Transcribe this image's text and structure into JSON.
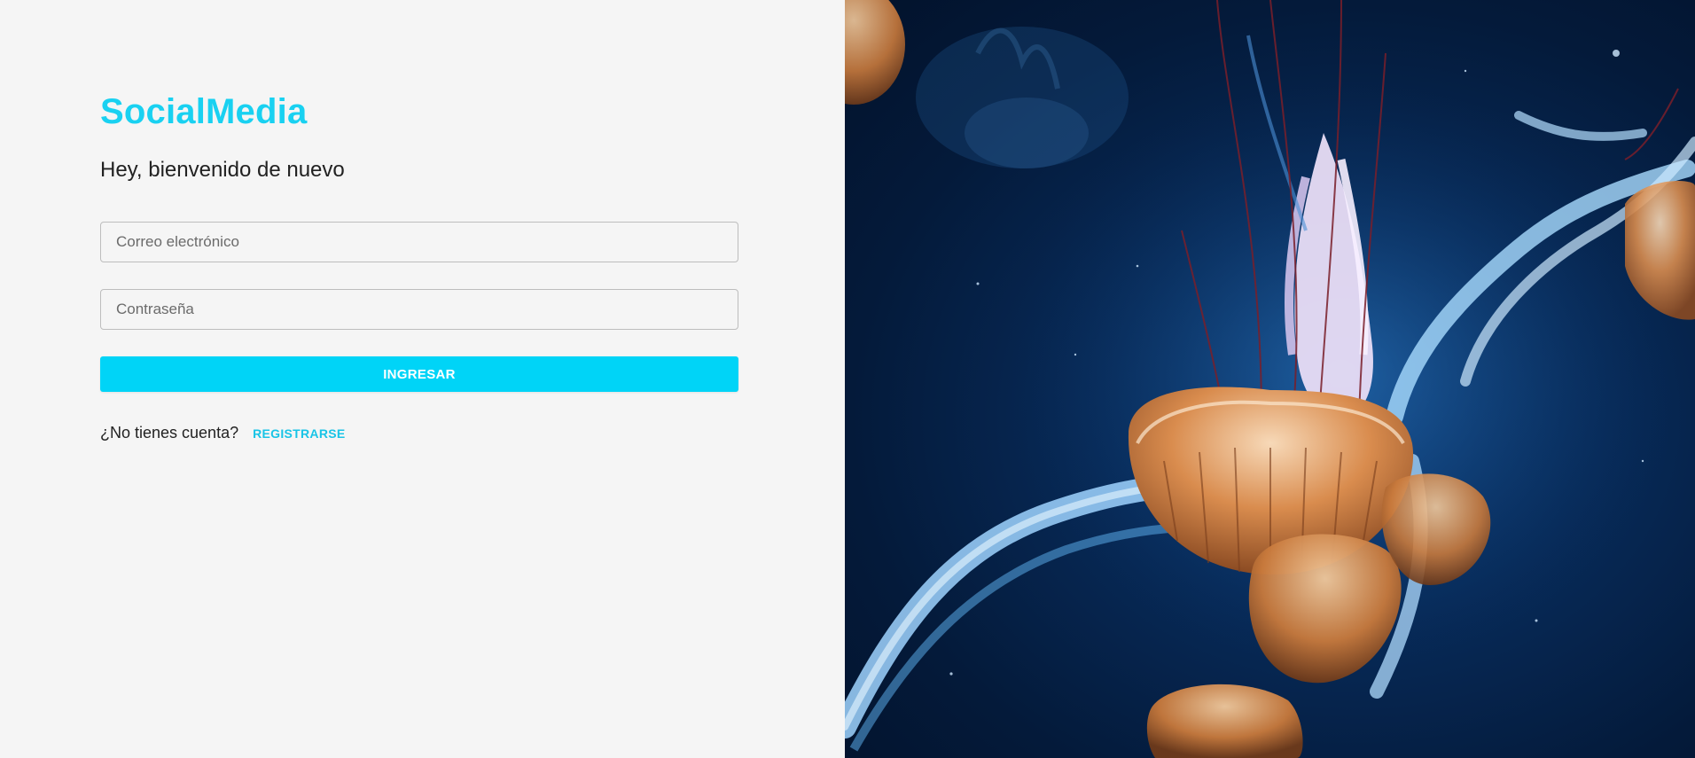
{
  "brand": {
    "name": "SocialMedia",
    "color": "#19d1f1"
  },
  "login": {
    "welcome": "Hey, bienvenido de nuevo",
    "email_placeholder": "Correo electrónico",
    "email_value": "",
    "password_placeholder": "Contraseña",
    "password_value": "",
    "submit_label": "INGRESAR",
    "submit_color": "#00d4f7"
  },
  "signup": {
    "prompt": "¿No tienes cuenta?",
    "link_label": "REGISTRARSE"
  },
  "hero_image": {
    "subject": "jellyfish-underwater-photo",
    "background_color": "#072a58"
  }
}
